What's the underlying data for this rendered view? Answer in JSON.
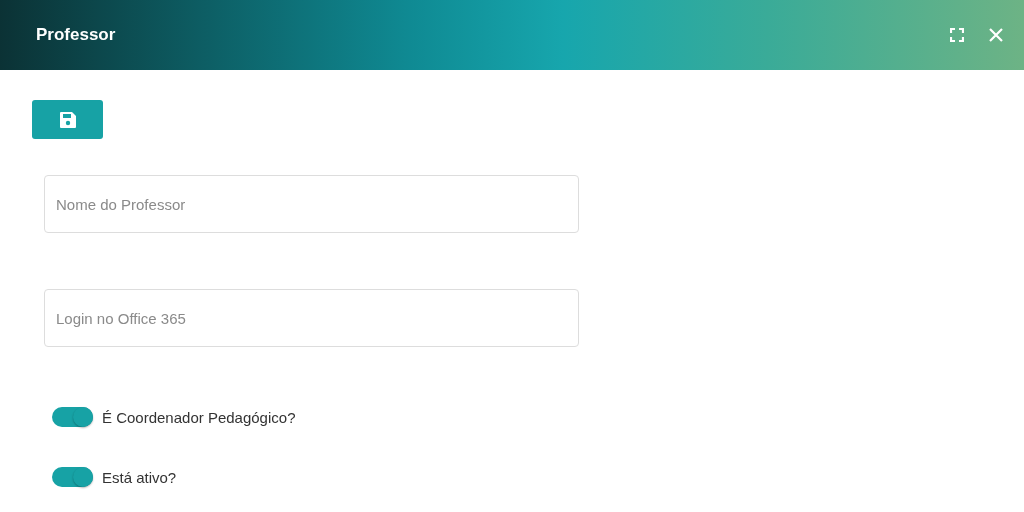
{
  "window": {
    "title": "Professor"
  },
  "fields": [
    {
      "placeholder": "Nome do Professor"
    },
    {
      "placeholder": "Login no Office 365"
    }
  ],
  "switches": [
    {
      "label": "É Coordenador Pedagógico?",
      "on": true
    },
    {
      "label": "Está ativo?",
      "on": true
    }
  ]
}
